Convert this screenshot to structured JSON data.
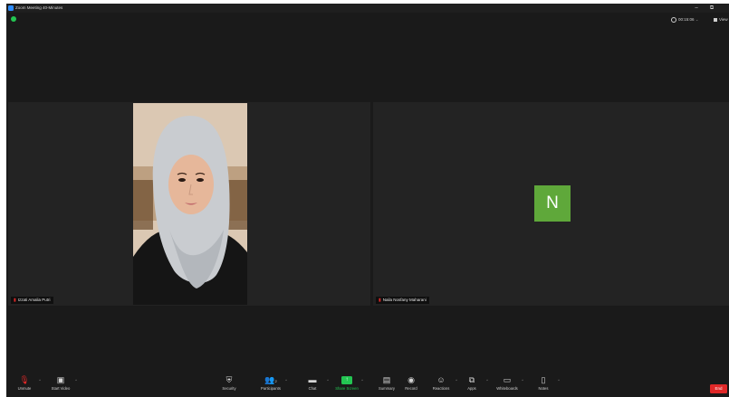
{
  "window": {
    "title": "Zoom Meeting 40-Minutes",
    "minimize_glyph": "–",
    "maximize_glyph": "⧉"
  },
  "top_controls": {
    "timer": "00:15:06",
    "view_label": "View"
  },
  "participants": [
    {
      "name": "Izzati Amalia Putri",
      "muted": true
    },
    {
      "name": "Naila Nosfany Maharani",
      "muted": true,
      "initial": "N",
      "avatar_color": "#5fa83a"
    }
  ],
  "toolbar": {
    "unmute": "Unmute",
    "start_video": "Start Video",
    "security": "Security",
    "participants": "Participants",
    "participants_count": "2",
    "chat": "Chat",
    "share_screen": "Share Screen",
    "summary": "Summary",
    "record": "Record",
    "reactions": "Reactions",
    "apps": "Apps",
    "whiteboards": "Whiteboards",
    "notes": "Notes",
    "end": "End"
  },
  "colors": {
    "background": "#1a1a1a",
    "tile": "#232323",
    "accent_green": "#23c552",
    "end_red": "#e02828"
  },
  "icons": {
    "unmute": "mic-off-icon",
    "start_video": "video-off-icon",
    "security": "shield-icon",
    "participants": "people-icon",
    "chat": "chat-icon",
    "share_screen": "share-screen-icon",
    "summary": "summary-icon",
    "record": "record-icon",
    "reactions": "reactions-icon",
    "apps": "apps-icon",
    "whiteboards": "whiteboard-icon",
    "notes": "notes-icon"
  }
}
